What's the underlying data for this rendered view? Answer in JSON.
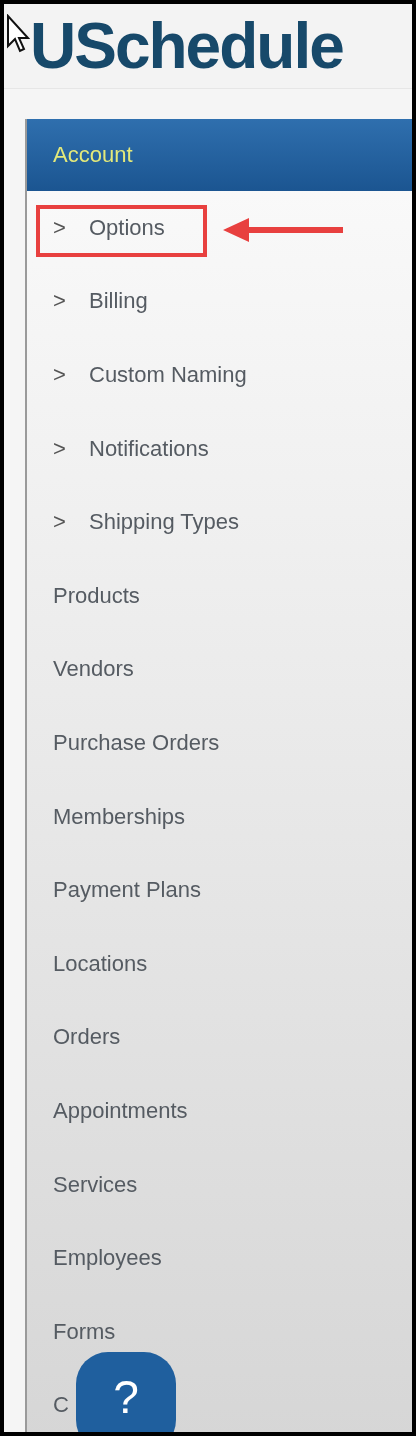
{
  "logo": {
    "text": "USchedule"
  },
  "sidebar": {
    "header": "Account",
    "items": [
      {
        "label": "Options",
        "marker": ">",
        "highlighted": true
      },
      {
        "label": "Billing",
        "marker": ">",
        "highlighted": false
      },
      {
        "label": "Custom Naming",
        "marker": ">",
        "highlighted": false
      },
      {
        "label": "Notifications",
        "marker": ">",
        "highlighted": false
      },
      {
        "label": "Shipping Types",
        "marker": ">",
        "highlighted": false
      },
      {
        "label": "Products",
        "highlighted": false
      },
      {
        "label": "Vendors",
        "highlighted": false
      },
      {
        "label": "Purchase Orders",
        "highlighted": false
      },
      {
        "label": "Memberships",
        "highlighted": false
      },
      {
        "label": "Payment Plans",
        "highlighted": false
      },
      {
        "label": "Locations",
        "highlighted": false
      },
      {
        "label": "Orders",
        "highlighted": false
      },
      {
        "label": "Appointments",
        "highlighted": false
      },
      {
        "label": "Services",
        "highlighted": false
      },
      {
        "label": "Employees",
        "highlighted": false
      },
      {
        "label": "Forms",
        "highlighted": false
      },
      {
        "label": "C",
        "highlighted": false
      }
    ]
  },
  "help_button": {
    "label": "?"
  }
}
